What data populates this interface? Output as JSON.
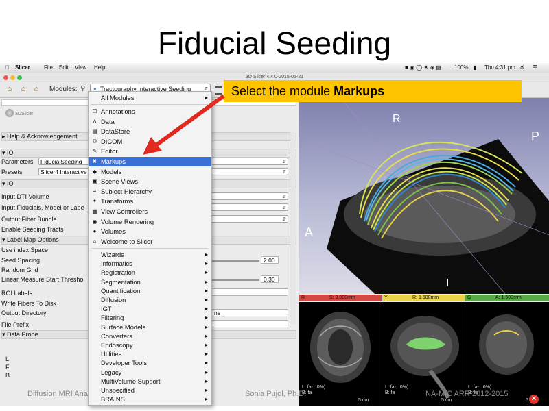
{
  "slide": {
    "title": "Fiducial Seeding",
    "callout": {
      "prefix": "Select the module ",
      "bold": "Markups"
    },
    "footer": {
      "left": "Diffusion MRI Analysis",
      "center": "Sonia Pujol, Ph.D.",
      "right": "NA-MIC ARR 2012-2015"
    }
  },
  "menubar": {
    "app": "Slicer",
    "items": [
      "File",
      "Edit",
      "View",
      "Help"
    ],
    "battery": "100%",
    "time": "Thu 4:31 pm"
  },
  "window": {
    "title": "3D Slicer 4.4.0-2015-05-21"
  },
  "toolbar": {
    "modules_label": "Modules:",
    "current_module": "Tractography Interactive Seeding"
  },
  "module_panel": {
    "logo": "3DSlicer",
    "help_section": "Help & Acknowledgement",
    "io_section": "IO",
    "parameters_label": "Parameters",
    "parameters_value": "FiducialSeeding",
    "presets_label": "Presets",
    "presets_value": "Slicer4 Interactive",
    "io_section2": "IO",
    "input_dti": "Input DTI Volume",
    "input_fiducials": "Input Fiducials, Model or Labe",
    "output_fiber": "Output Fiber Bundle",
    "enable_seeding": "Enable Seeding Tracts",
    "label_map_section": "Label Map Options",
    "use_index": "Use index Space",
    "seed_spacing": "Seed Spacing",
    "seed_spacing_value": "2.00",
    "random_grid": "Random Grid",
    "linear_measure": "Linear Measure Start Thresho",
    "linear_measure_value": "0.30",
    "roi_labels": "ROI Labels",
    "write_fibers": "Write Fibers To Disk",
    "output_directory": "Output Directory",
    "output_directory_tail": "ns",
    "file_prefix": "File Prefix",
    "data_probe_section": "Data Probe",
    "probe_letters": [
      "L",
      "F",
      "B"
    ]
  },
  "modules_menu": {
    "all_modules": "All Modules",
    "items": [
      {
        "label": "Annotations",
        "icon": "annotation-icon"
      },
      {
        "label": "Data",
        "icon": "data-icon"
      },
      {
        "label": "DataStore",
        "icon": "datastore-icon"
      },
      {
        "label": "DICOM",
        "icon": "dicom-icon"
      },
      {
        "label": "Editor",
        "icon": "editor-icon"
      },
      {
        "label": "Markups",
        "icon": "markups-icon",
        "selected": true
      },
      {
        "label": "Models",
        "icon": "models-icon"
      },
      {
        "label": "Scene Views",
        "icon": "sceneviews-icon"
      },
      {
        "label": "Subject Hierarchy",
        "icon": "hierarchy-icon"
      },
      {
        "label": "Transforms",
        "icon": "transforms-icon"
      },
      {
        "label": "View Controllers",
        "icon": "viewcontrollers-icon"
      },
      {
        "label": "Volume Rendering",
        "icon": "volumerendering-icon"
      },
      {
        "label": "Volumes",
        "icon": "volumes-icon"
      },
      {
        "label": "Welcome to Slicer",
        "icon": "welcome-icon"
      }
    ],
    "categories": [
      "Wizards",
      "Informatics",
      "Registration",
      "Segmentation",
      "Quantification",
      "Diffusion",
      "IGT",
      "Filtering",
      "Surface Models",
      "Converters",
      "Endoscopy",
      "Utilities",
      "Developer Tools",
      "Legacy",
      "MultiVolume Support",
      "Unspecified",
      "BRAINS"
    ]
  },
  "viewer3d": {
    "labels": {
      "top": "R",
      "right": "P",
      "left": "A",
      "bottom": "I"
    }
  },
  "slice_views": [
    {
      "letter": "R",
      "offset": "S: 0.000mm",
      "color": "#d24a43",
      "info1": "L: fa-...0%)",
      "info2": "B: fa",
      "scale": "5 cm"
    },
    {
      "letter": "Y",
      "offset": "R: 1.500mm",
      "color": "#e9d34a",
      "info1": "L: fa-...0%)",
      "info2": "B: fa",
      "scale": "5 cm"
    },
    {
      "letter": "G",
      "offset": "A: 1.500mm",
      "color": "#58a845",
      "info1": "L: fa-...0%)",
      "info2": "B: fa",
      "scale": "5 cm"
    }
  ],
  "colors": {
    "callout": "#ffc400",
    "menu_highlight": "#3a6fd6",
    "arrow": "#e02a1f"
  }
}
